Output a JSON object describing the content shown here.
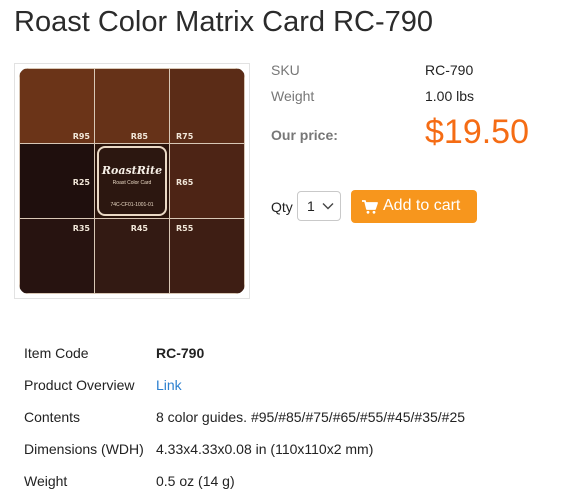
{
  "product": {
    "title": "Roast Color Matrix Card RC-790"
  },
  "card_image": {
    "logo": "RoastRite",
    "subtitle": "Roast Color Card",
    "code": "74C-CF01-1001-01",
    "cells": [
      {
        "label": "R95",
        "color": "#6b3418"
      },
      {
        "label": "R85",
        "color": "#663218"
      },
      {
        "label": "R75",
        "color": "#5b2c17"
      },
      {
        "label": "R25",
        "color": "#1f0f0d"
      },
      {
        "label": "R65",
        "color": "#4d2415"
      },
      {
        "label": "R35",
        "color": "#271310"
      },
      {
        "label": "R45",
        "color": "#331a13"
      },
      {
        "label": "R55",
        "color": "#3e1e14"
      }
    ]
  },
  "info": {
    "sku_label": "SKU",
    "sku_value": "RC-790",
    "weight_label": "Weight",
    "weight_value": "1.00 lbs",
    "price_label": "Our price:",
    "price_value": "$19.50"
  },
  "purchase": {
    "qty_label": "Qty",
    "qty_value": "1",
    "add_to_cart": "Add to cart",
    "accent_color": "#f7961d",
    "price_color": "#f56c14"
  },
  "specs": [
    {
      "label": "Item Code",
      "value": "RC-790"
    },
    {
      "label": "Product Overview",
      "value": "Link"
    },
    {
      "label": "Contents",
      "value": "8 color guides. #95/#85/#75/#65/#55/#45/#35/#25"
    },
    {
      "label": "Dimensions (WDH)",
      "value": "4.33x4.33x0.08 in (110x110x2 mm)"
    },
    {
      "label": "Weight",
      "value": "0.5 oz (14 g)"
    }
  ]
}
